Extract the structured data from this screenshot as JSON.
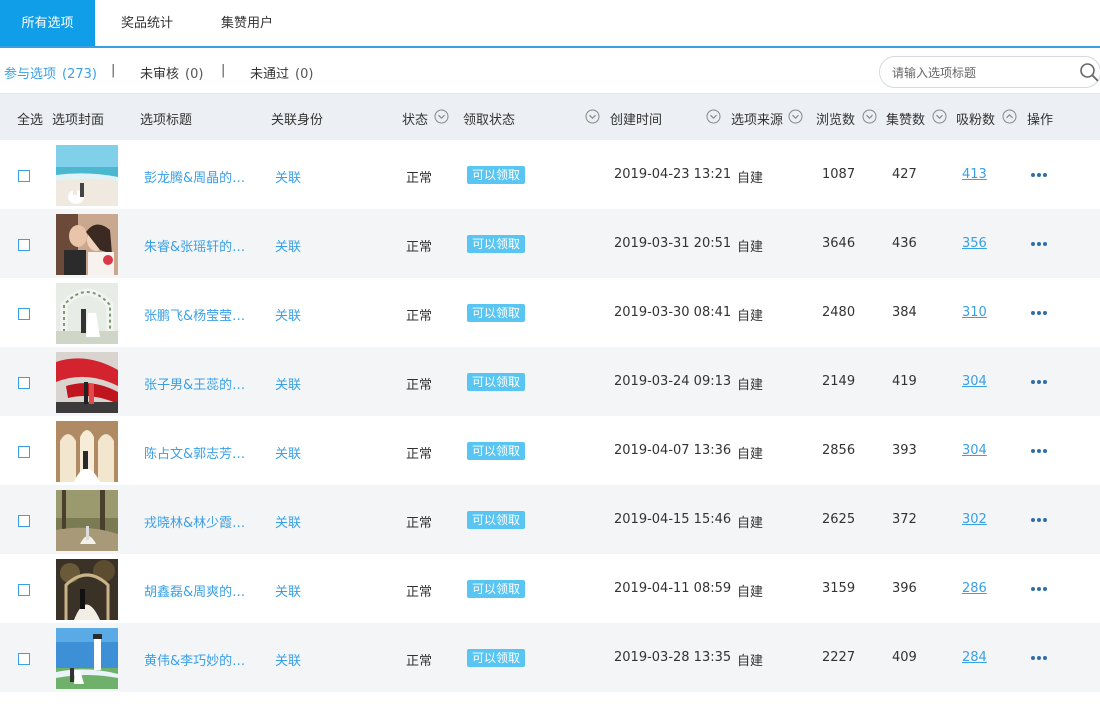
{
  "tabs": [
    {
      "label": "所有选项",
      "active": true
    },
    {
      "label": "奖品统计",
      "active": false
    },
    {
      "label": "集赞用户",
      "active": false
    }
  ],
  "filters": [
    {
      "label": "参与选项",
      "count": "(273)",
      "active": true
    },
    {
      "label": "未审核",
      "count": "(0)",
      "active": false
    },
    {
      "label": "未通过",
      "count": "(0)",
      "active": false
    }
  ],
  "separator": "|",
  "search": {
    "placeholder": "请输入选项标题",
    "icon": "search-icon"
  },
  "columns": {
    "select_all": "全选",
    "cover": "选项封面",
    "title": "选项标题",
    "identity": "关联身份",
    "status": "状态",
    "claim_status": "领取状态",
    "created": "创建时间",
    "source": "选项来源",
    "views": "浏览数",
    "likes": "集赞数",
    "fans": "吸粉数",
    "actions": "操作"
  },
  "colors": {
    "accent": "#109ee9",
    "link": "#3aa0e6",
    "badge": "#59c5f3",
    "header_bg": "#eceff3",
    "alt_row": "#f4f5f7"
  },
  "rows": [
    {
      "title": "彭龙腾&周晶的婚...",
      "identity": "关联",
      "status": "正常",
      "claim": "可以领取",
      "created": "2019-04-23 13:21",
      "source": "自建",
      "views": "1087",
      "likes": "427",
      "fans": "413",
      "cover": "beach-wedding-photo"
    },
    {
      "title": "朱睿&张瑶轩的婚...",
      "identity": "关联",
      "status": "正常",
      "claim": "可以领取",
      "created": "2019-03-31 20:51",
      "source": "自建",
      "views": "3646",
      "likes": "436",
      "fans": "356",
      "cover": "couple-closeup-photo"
    },
    {
      "title": "张鹏飞&杨莹莹的...",
      "identity": "关联",
      "status": "正常",
      "claim": "可以领取",
      "created": "2019-03-30 08:41",
      "source": "自建",
      "views": "2480",
      "likes": "384",
      "fans": "310",
      "cover": "flower-arch-photo"
    },
    {
      "title": "张子男&王蕊的婚...",
      "identity": "关联",
      "status": "正常",
      "claim": "可以领取",
      "created": "2019-03-24 09:13",
      "source": "自建",
      "views": "2149",
      "likes": "419",
      "fans": "304",
      "cover": "red-veil-photo"
    },
    {
      "title": "陈占文&郭志芳的...",
      "identity": "关联",
      "status": "正常",
      "claim": "可以领取",
      "created": "2019-04-07 13:36",
      "source": "自建",
      "views": "2856",
      "likes": "393",
      "fans": "304",
      "cover": "church-hall-photo"
    },
    {
      "title": "戎晓林&林少霞的...",
      "identity": "关联",
      "status": "正常",
      "claim": "可以领取",
      "created": "2019-04-15 15:46",
      "source": "自建",
      "views": "2625",
      "likes": "372",
      "fans": "302",
      "cover": "forest-wedding-photo"
    },
    {
      "title": "胡鑫磊&周爽的婚...",
      "identity": "关联",
      "status": "正常",
      "claim": "可以领取",
      "created": "2019-04-11 08:59",
      "source": "自建",
      "views": "3159",
      "likes": "396",
      "fans": "286",
      "cover": "night-garden-photo"
    },
    {
      "title": "黄伟&李巧妙的婚...",
      "identity": "关联",
      "status": "正常",
      "claim": "可以领取",
      "created": "2019-03-28 13:35",
      "source": "自建",
      "views": "2227",
      "likes": "409",
      "fans": "284",
      "cover": "lighthouse-photo"
    }
  ]
}
